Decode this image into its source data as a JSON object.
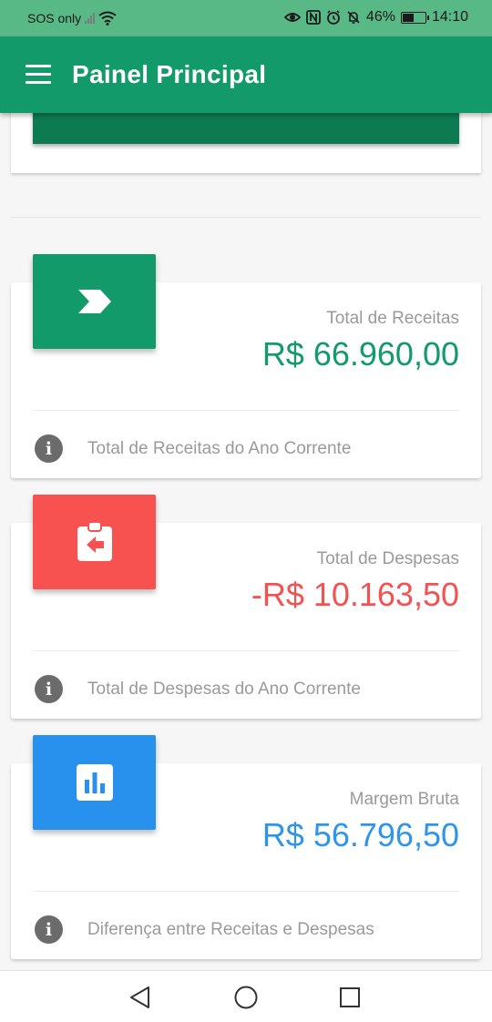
{
  "status_bar": {
    "carrier": "SOS only",
    "battery_percent": "46%",
    "time": "14:10",
    "icons": [
      "wifi-icon",
      "eye-icon",
      "nfc-icon",
      "alarm-icon",
      "bell-off-icon",
      "battery-icon"
    ]
  },
  "app_bar": {
    "title": "Painel Principal",
    "menu_icon": "menu-icon",
    "color": "#129a6b"
  },
  "cards": [
    {
      "label": "Total de Receitas",
      "value": "R$ 66.960,00",
      "footer": "Total de Receitas do Ano Corrente",
      "icon": "chevron-right-icon",
      "color": "#129a6b"
    },
    {
      "label": "Total de Despesas",
      "value": "-R$ 10.163,50",
      "footer": "Total de Despesas do Ano Corrente",
      "icon": "clipboard-arrow-left-icon",
      "color": "#f75250"
    },
    {
      "label": "Margem Bruta",
      "value": "R$ 56.796,50",
      "footer": "Diferença entre Receitas e Despesas",
      "icon": "bar-chart-icon",
      "color": "#2891ee"
    }
  ],
  "nav_bar": {
    "buttons": [
      "back-icon",
      "home-icon",
      "recents-icon"
    ]
  }
}
